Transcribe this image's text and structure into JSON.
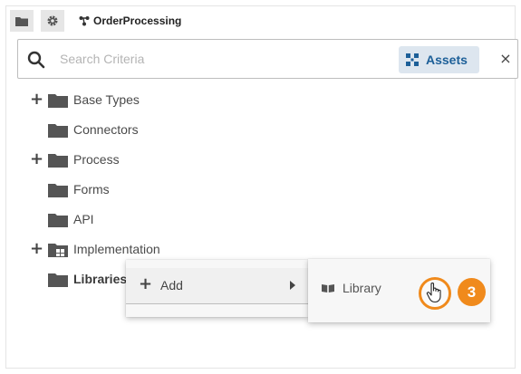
{
  "toolbar": {
    "folder_icon": "folder-icon",
    "settings_icon": "gear-icon",
    "breadcrumb_icon": "process-flow-icon",
    "breadcrumb_label": "OrderProcessing"
  },
  "search": {
    "placeholder": "Search Criteria",
    "value": "",
    "filter_label": "Assets",
    "filter_icon": "assets-icon",
    "close_label": "×"
  },
  "tree": {
    "items": [
      {
        "label": "Base Types",
        "expandable": true,
        "icon": "folder-icon"
      },
      {
        "label": "Connectors",
        "expandable": false,
        "icon": "folder-icon"
      },
      {
        "label": "Process",
        "expandable": true,
        "icon": "folder-icon"
      },
      {
        "label": "Forms",
        "expandable": false,
        "icon": "folder-icon"
      },
      {
        "label": "API",
        "expandable": false,
        "icon": "folder-icon"
      },
      {
        "label": "Implementation",
        "expandable": true,
        "icon": "implementation-folder-icon"
      },
      {
        "label": "Libraries",
        "expandable": false,
        "icon": "folder-icon",
        "selected": true
      }
    ]
  },
  "context_menu": {
    "add_label": "Add",
    "submenu": {
      "library_label": "Library",
      "library_icon": "book-icon"
    }
  },
  "annotation": {
    "step_number": "3"
  },
  "colors": {
    "accent": "#1c5f98",
    "assets_bg": "#dde6ef",
    "highlight": "#f08a1c",
    "folder": "#555555"
  }
}
